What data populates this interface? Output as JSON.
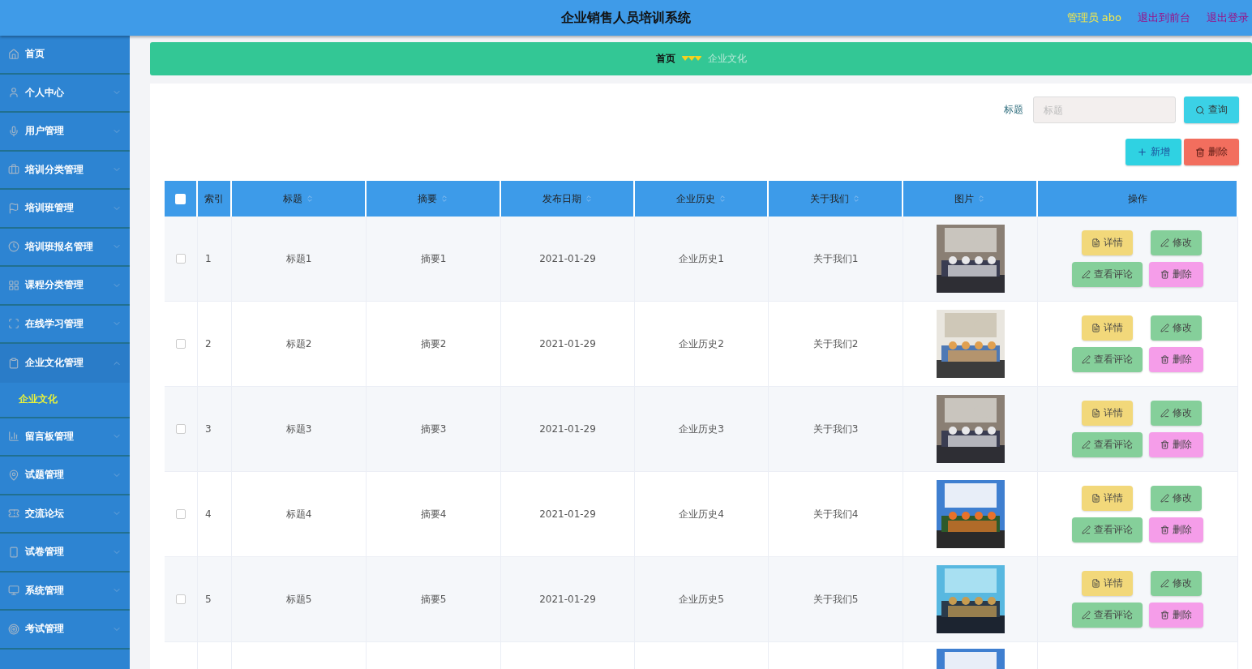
{
  "header": {
    "title": "企业销售人员培训系统",
    "user": "管理员 abo",
    "links": [
      "退出到前台",
      "退出登录"
    ]
  },
  "sidebar": {
    "items": [
      {
        "label": "首页"
      },
      {
        "label": "个人中心",
        "expanded": false
      },
      {
        "label": "用户管理",
        "expanded": false
      },
      {
        "label": "培训分类管理",
        "expanded": false
      },
      {
        "label": "培训班管理",
        "expanded": false
      },
      {
        "label": "培训班报名管理",
        "expanded": false
      },
      {
        "label": "课程分类管理",
        "expanded": false
      },
      {
        "label": "在线学习管理",
        "expanded": false
      },
      {
        "label": "企业文化管理",
        "expanded": true,
        "children": [
          {
            "label": "企业文化",
            "selected": true
          }
        ]
      },
      {
        "label": "留言板管理",
        "expanded": false
      },
      {
        "label": "试题管理",
        "expanded": false
      },
      {
        "label": "交流论坛",
        "expanded": false
      },
      {
        "label": "试卷管理",
        "expanded": false
      },
      {
        "label": "系统管理",
        "expanded": false
      },
      {
        "label": "考试管理",
        "expanded": false
      }
    ]
  },
  "breadcrumb": {
    "home": "首页",
    "current": "企业文化"
  },
  "search": {
    "label": "标题",
    "placeholder": "标题",
    "button": "查询"
  },
  "actions": {
    "add": "新增",
    "delete": "删除"
  },
  "table": {
    "select_all": {
      "checked": false
    },
    "columns": [
      {
        "label": "索引",
        "sortable": false
      },
      {
        "label": "标题",
        "sortable": true
      },
      {
        "label": "摘要",
        "sortable": true
      },
      {
        "label": "发布日期",
        "sortable": true
      },
      {
        "label": "企业历史",
        "sortable": true
      },
      {
        "label": "关于我们",
        "sortable": true
      },
      {
        "label": "图片",
        "sortable": true
      },
      {
        "label": "操作",
        "sortable": false
      }
    ],
    "rows": [
      {
        "checked": false,
        "index": "1",
        "title": "标题1",
        "summary": "摘要1",
        "date": "2021-01-29",
        "history": "企业历史1",
        "about": "关于我们1",
        "picture": {
          "kind": "picture"
        },
        "buttons": [
          "详情",
          "修改",
          "查看评论",
          "删除"
        ]
      },
      {
        "checked": false,
        "index": "2",
        "title": "标题2",
        "summary": "摘要2",
        "date": "2021-01-29",
        "history": "企业历史2",
        "about": "关于我们2",
        "picture": {
          "kind": "picture"
        },
        "buttons": [
          "详情",
          "修改",
          "查看评论",
          "删除"
        ]
      },
      {
        "checked": false,
        "index": "3",
        "title": "标题3",
        "summary": "摘要3",
        "date": "2021-01-29",
        "history": "企业历史3",
        "about": "关于我们3",
        "picture": {
          "kind": "picture"
        },
        "buttons": [
          "详情",
          "修改",
          "查看评论",
          "删除"
        ]
      },
      {
        "checked": false,
        "index": "4",
        "title": "标题4",
        "summary": "摘要4",
        "date": "2021-01-29",
        "history": "企业历史4",
        "about": "关于我们4",
        "picture": {
          "kind": "picture"
        },
        "buttons": [
          "详情",
          "修改",
          "查看评论",
          "删除"
        ]
      },
      {
        "checked": false,
        "index": "5",
        "title": "标题5",
        "summary": "摘要5",
        "date": "2021-01-29",
        "history": "企业历史5",
        "about": "关于我们5",
        "picture": {
          "kind": "picture"
        },
        "buttons": [
          "详情",
          "修改",
          "查看评论",
          "删除"
        ]
      },
      {
        "picture": {
          "kind": "picture"
        }
      }
    ]
  }
}
